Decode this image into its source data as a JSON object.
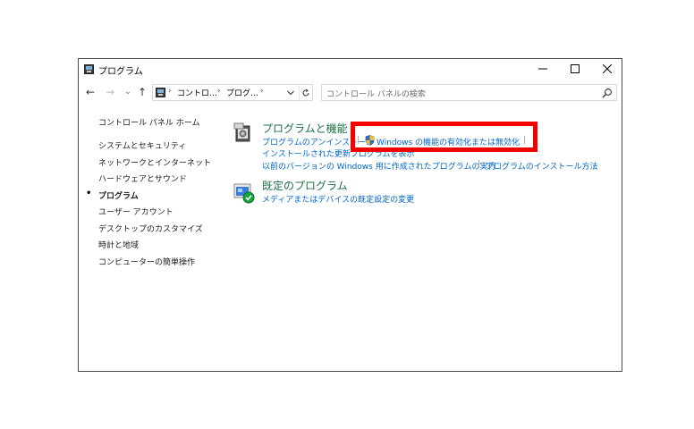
{
  "window": {
    "title": "プログラム",
    "controls": {
      "minimize": "—",
      "maximize": "☐",
      "close": "✕"
    }
  },
  "nav": {
    "back": "←",
    "forward": "→",
    "recent": "⌄",
    "up": "↑",
    "breadcrumbs": [
      "コントロ…",
      "プログ…"
    ],
    "search_placeholder": "コントロール パネルの検索"
  },
  "sidebar": {
    "home": "コントロール パネル ホーム",
    "items": [
      {
        "label": "システムとセキュリティ"
      },
      {
        "label": "ネットワークとインターネット"
      },
      {
        "label": "ハードウェアとサウンド"
      },
      {
        "label": "プログラム",
        "active": true
      },
      {
        "label": "ユーザー アカウント"
      },
      {
        "label": "デスクトップのカスタマイズ"
      },
      {
        "label": "時計と地域"
      },
      {
        "label": "コンピューターの簡単操作"
      }
    ]
  },
  "main": {
    "programs": {
      "title": "プログラムと機能",
      "links": {
        "uninstall": "プログラムのアンインストール",
        "windows_features": "Windows の機能の有効化または無効化",
        "view_updates": "インストールされた更新プログラムを表示",
        "run_older": "以前のバージョンの Windows 用に作成されたプログラムの実行",
        "how_to_install": "プログラムのインストール方法"
      }
    },
    "defaults": {
      "title": "既定のプログラム",
      "link": "メディアまたはデバイスの既定設定の変更"
    }
  },
  "colors": {
    "category_title": "#1e7145",
    "link": "#0066cc",
    "highlight_border": "#f20000"
  }
}
